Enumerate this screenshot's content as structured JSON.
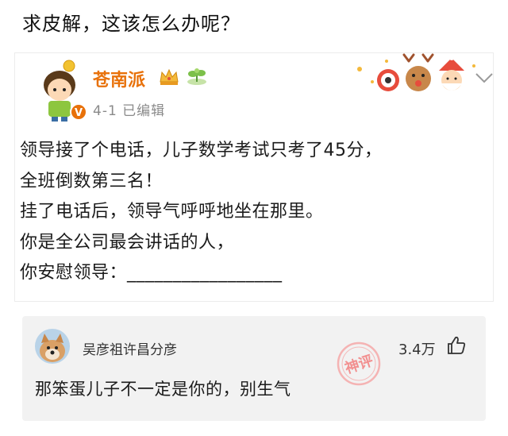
{
  "question": "求皮解，这该怎么办呢？",
  "post": {
    "username": "苍南派",
    "meta": "4-1  已编辑",
    "lines": [
      "领导接了个电话，儿子数学考试只考了45分，",
      "全班倒数第三名！",
      "挂了电话后，领导气呼呼地坐在那里。",
      "你是全公司最会讲话的人，",
      "你安慰领导：_________________"
    ]
  },
  "comment": {
    "username": "吴彦祖许昌分彦",
    "likes": "3.4万",
    "text": "那笨蛋儿子不一定是你的，别生气",
    "stamp_text": "神评"
  },
  "colors": {
    "username": "#e8710a",
    "comment_bg": "#f2f2f2",
    "stamp": "#f5a3a3"
  }
}
